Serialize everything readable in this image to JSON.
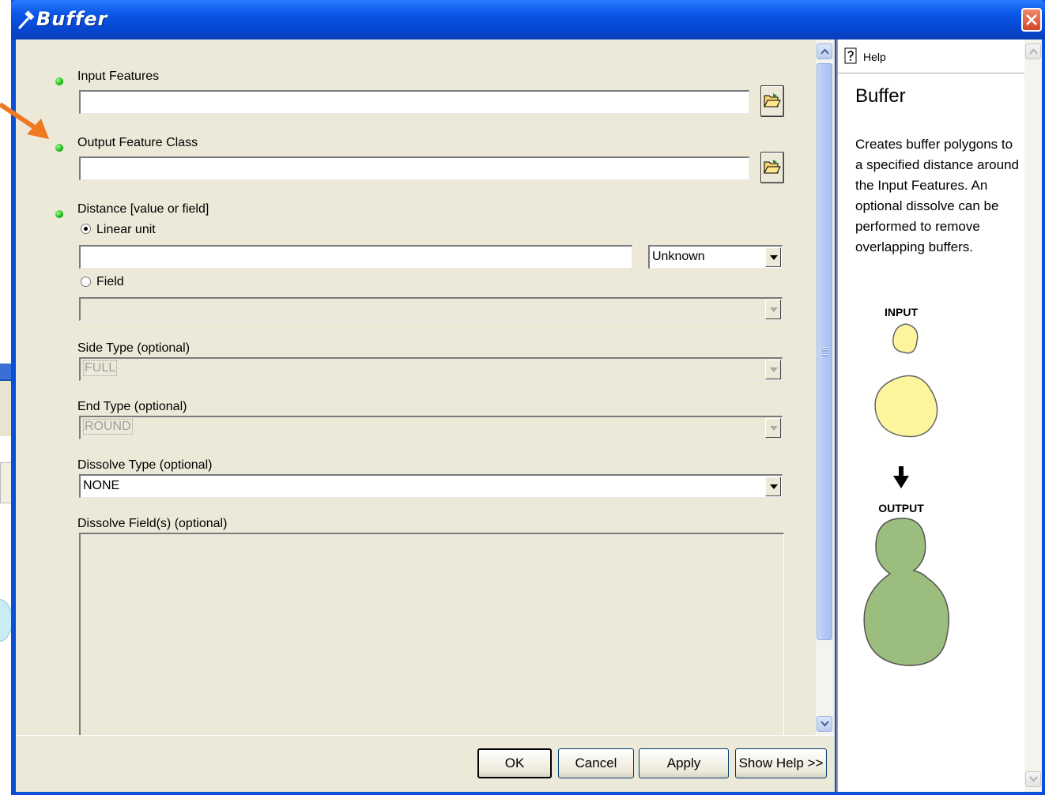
{
  "window": {
    "title": "Buffer"
  },
  "form": {
    "input_features": {
      "label": "Input Features",
      "value": ""
    },
    "output_feature_class": {
      "label": "Output Feature Class",
      "value": ""
    },
    "distance": {
      "label": "Distance [value or field]",
      "linear_unit_label": "Linear unit",
      "linear_value": "",
      "unit_selected": "Unknown",
      "field_label": "Field",
      "field_value": "",
      "selected": "linear"
    },
    "side_type": {
      "label": "Side Type (optional)",
      "value": "FULL"
    },
    "end_type": {
      "label": "End Type (optional)",
      "value": "ROUND"
    },
    "dissolve_type": {
      "label": "Dissolve Type (optional)",
      "value": "NONE"
    },
    "dissolve_fields": {
      "label": "Dissolve Field(s) (optional)"
    }
  },
  "buttons": {
    "ok": "OK",
    "cancel": "Cancel",
    "apply": "Apply",
    "show_help": "Show Help >>"
  },
  "help": {
    "header": "Help",
    "title": "Buffer",
    "description": "Creates buffer polygons to a specified distance around the Input Features. An optional dissolve can be performed to remove overlapping buffers.",
    "diagram_input_label": "INPUT",
    "diagram_output_label": "OUTPUT"
  },
  "colors": {
    "titlebar": "#0a57e8",
    "dialog_bg": "#ece9d8",
    "required_dot": "#14b814",
    "annotation_arrow": "#f07820",
    "input_shape": "#fdf59e",
    "output_shape": "#9bbd7e"
  },
  "icons": [
    "hammer-icon",
    "close-icon",
    "folder-open-icon",
    "help-icon",
    "down-arrow-icon"
  ]
}
